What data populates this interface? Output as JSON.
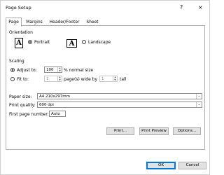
{
  "window": {
    "title": "Page Setup",
    "help_label": "?",
    "close_label": "×"
  },
  "tabs": [
    "Page",
    "Margins",
    "Header/Footer",
    "Sheet"
  ],
  "orientation": {
    "group_label": "Orientation",
    "portrait_label": "Portrait",
    "landscape_label": "Landscape",
    "selected": "Portrait",
    "icon_glyph": "A"
  },
  "scaling": {
    "group_label": "Scaling",
    "adjust_label": "Adjust to:",
    "adjust_value": "100",
    "adjust_suffix": "% normal size",
    "fit_label": "Fit to:",
    "fit_pages_wide": "1",
    "fit_wide_label": "page(s) wide by",
    "fit_pages_tall": "1",
    "fit_tall_label": "tall",
    "selected": "Adjust to"
  },
  "paper_size": {
    "label": "Paper size:",
    "value": "A4 210x297mm"
  },
  "print_quality": {
    "label": "Print quality:",
    "value": "600 dpi"
  },
  "first_page": {
    "label": "First page number:",
    "value": "Auto"
  },
  "buttons": {
    "print": "Print...",
    "print_preview": "Print Preview",
    "options": "Options...",
    "ok": "OK",
    "cancel": "Cancel"
  }
}
